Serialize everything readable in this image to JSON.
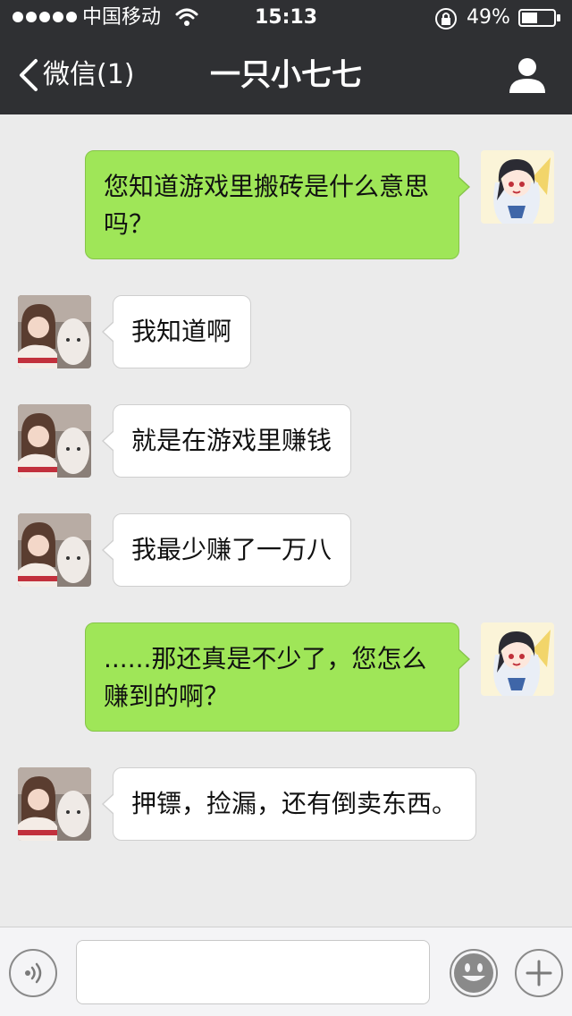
{
  "status_bar": {
    "carrier": "中国移动",
    "time": "15:13",
    "battery": "49%",
    "signal_bars": 5,
    "battery_level": 0.49
  },
  "nav": {
    "back_label": "微信(1)",
    "title": "一只小七七"
  },
  "messages": [
    {
      "side": "out",
      "sender": "me",
      "text": "您知道游戏里搬砖是什么意思吗？"
    },
    {
      "side": "in",
      "sender": "contact",
      "text": "我知道啊"
    },
    {
      "side": "in",
      "sender": "contact",
      "text": "就是在游戏里赚钱"
    },
    {
      "side": "in",
      "sender": "contact",
      "text": "我最少赚了一万八"
    },
    {
      "side": "out",
      "sender": "me",
      "text": "......那还真是不少了，您怎么赚到的啊？"
    },
    {
      "side": "in",
      "sender": "contact",
      "text": "押镖，捡漏，还有倒卖东西。"
    }
  ],
  "input_bar": {
    "message_value": "",
    "voice_icon": "voice-icon",
    "emoji_icon": "emoji-icon",
    "plus_icon": "plus-icon"
  },
  "colors": {
    "header_bg": "#2f3033",
    "chat_bg": "#ebebeb",
    "outgoing_bubble": "#9fe658",
    "incoming_bubble": "#ffffff"
  }
}
